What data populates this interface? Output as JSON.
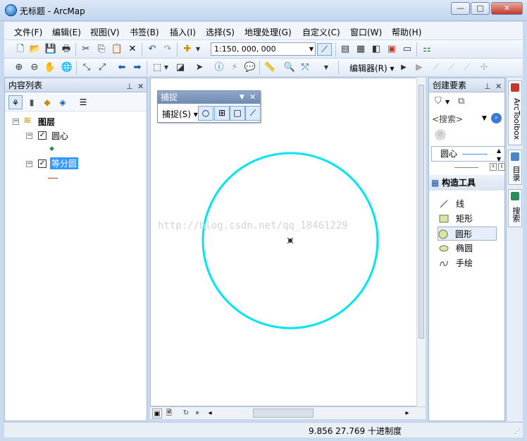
{
  "window": {
    "title": "无标题 - ArcMap",
    "controls": {
      "minimize": "—",
      "maximize": "□",
      "close": "✕"
    }
  },
  "menu": [
    "文件(F)",
    "编辑(E)",
    "视图(V)",
    "书签(B)",
    "插入(I)",
    "选择(S)",
    "地理处理(G)",
    "自定义(C)",
    "窗口(W)",
    "帮助(H)"
  ],
  "toolbar": {
    "scale": "1:150, 000, 000",
    "editor_menu": "编辑器(R)"
  },
  "toc": {
    "title": "内容列表",
    "group": "图层",
    "layers": [
      {
        "name": "圆心",
        "checked": true,
        "symbol": "point"
      },
      {
        "name": "等分圆",
        "checked": true,
        "symbol": "line"
      }
    ]
  },
  "snapping": {
    "title": "捕捉",
    "menu": "捕捉(S)"
  },
  "map": {
    "watermark": "http://blog.csdn.net/qq_18461229",
    "circle_color": "#00e5ee"
  },
  "create_features": {
    "title": "创建要素",
    "search_placeholder": "<搜索>",
    "template": "圆心",
    "construction_title": "构造工具",
    "tools": [
      {
        "name": "线",
        "icon": "line-icon"
      },
      {
        "name": "矩形",
        "icon": "rectangle-icon"
      },
      {
        "name": "圆形",
        "icon": "circle-icon",
        "selected": true
      },
      {
        "name": "椭圆",
        "icon": "ellipse-icon"
      },
      {
        "name": "手绘",
        "icon": "freehand-icon"
      }
    ]
  },
  "dock_tabs": [
    "ArcToolbox",
    "目录",
    "搜索"
  ],
  "status": {
    "coords": "9.856  27.769 十进制度"
  }
}
